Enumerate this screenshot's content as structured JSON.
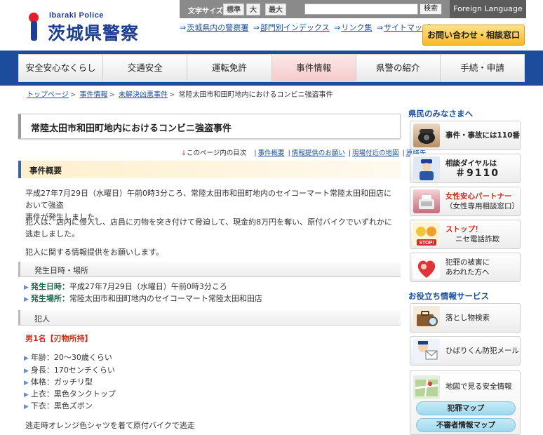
{
  "header": {
    "logo_en": "Ibaraki Police",
    "logo_ja": "茨城県警察",
    "font_size_label": "文字サイズ",
    "font_sizes": [
      "標準",
      "大",
      "最大"
    ],
    "search_button": "検索",
    "foreign_language": "Foreign Language",
    "links": [
      "茨城県内の警察署",
      "部門別インデックス",
      "リンク集",
      "サイトマップ"
    ],
    "contact_button": "お問い合わせ・相談窓口"
  },
  "nav": [
    "安全安心なくらし",
    "交通安全",
    "運転免許",
    "事件情報",
    "県警の紹介",
    "手続・申請"
  ],
  "breadcrumb": [
    "トップページ",
    "事件情報",
    "未解決凶悪事件",
    "常陸太田市和田町地内におけるコンビニ強盗事件"
  ],
  "main": {
    "title": "常陸太田市和田町地内におけるコンビニ強盗事件",
    "toc": {
      "label": "このページ内の目次",
      "items": [
        "事件概要",
        "情報提供のお願い",
        "現場付近の地図",
        "連絡先"
      ]
    },
    "section_title": "事件概要",
    "para1a": "平成27年7月29日（水曜日）午前0時3分ころ、常陸太田市和田町地内のセイコーマート常陸太田和田店において強盗",
    "para1b": "事件が発生しました。",
    "para2": "犯人は、店内に侵入し、店員に刃物を突き付けて脅迫して、現金約8万円を奪い、原付バイクでいずれかに逃走しました。",
    "para3": "犯人に関する情報提供をお願いします。",
    "sub1": "発生日時・場所",
    "date_label": "発生日時：",
    "date_value": "平成27年7月29日（水曜日）午前0時3分ころ",
    "place_label": "発生場所：",
    "place_value": "常陸太田市和田町地内のセイコーマート常陸太田和田店",
    "sub2": "犯人",
    "person_title": "男1名【刃物所持】",
    "traits": [
      "年齢：20～30歳くらい",
      "身長：170センチくらい",
      "体格：ガッチリ型",
      "上衣：黒色タンクトップ",
      "下衣：黒色ズボン"
    ],
    "escape": "逃走時オレンジ色シャツを着て原付バイクで逃走"
  },
  "sidebar": {
    "heading1": "県民のみなさまへ",
    "emergency": "事件・事故には110番",
    "consult_line1": "相談ダイヤルは",
    "consult_line2": "＃9110",
    "women_line1": "女性安心パートナー",
    "women_line2": "（女性専用相談窓口）",
    "fraud_line1": "ストップ！",
    "fraud_line2": "ニセ電話詐欺",
    "victim_line1": "犯罪の被害に",
    "victim_line2": "あわれた方へ",
    "heading2": "お役立ち情報サービス",
    "lost": "落とし物検索",
    "mail": "ひばりくん防犯メール",
    "map": "地図で見る安全情報",
    "crime_map": "犯罪マップ",
    "suspicious_map": "不審者情報マップ"
  },
  "colors": {
    "brand_blue": "#1c4d9c",
    "accent_red": "#cf2b1a",
    "label_green": "#1c6a4a"
  }
}
